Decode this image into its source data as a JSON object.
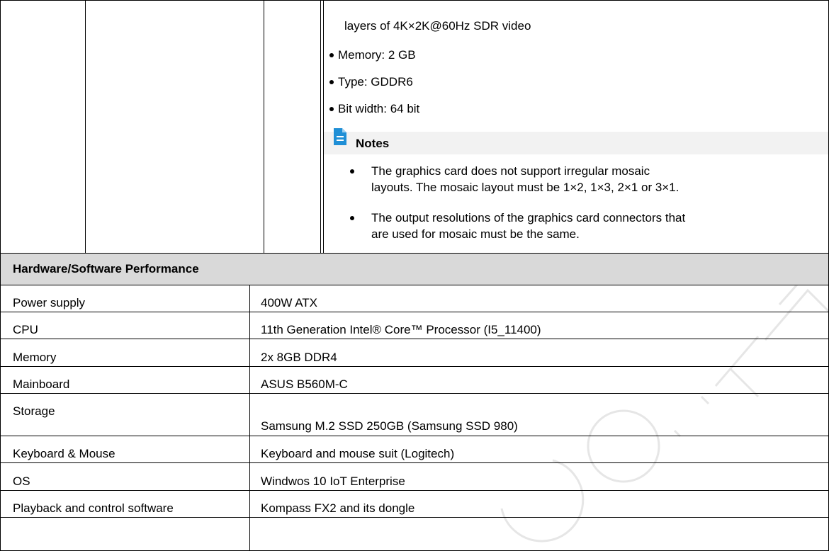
{
  "continued_cell": {
    "lines": [
      "layers of 4K×2K@60Hz SDR video",
      "Memory: 2 GB",
      "Type: GDDR6",
      "Bit width: 64 bit"
    ],
    "notes_title": "Notes",
    "notes": [
      [
        "The graphics card does not support irregular mosaic",
        "layouts. The mosaic layout must be 1×2, 1×3, 2×1 or 3×1."
      ],
      [
        "The output resolutions of the graphics card connectors that",
        "are used for mosaic must be the same."
      ]
    ]
  },
  "section": {
    "title": "Hardware/Software Performance"
  },
  "rows": [
    {
      "label": "Power supply",
      "value": "400W ATX"
    },
    {
      "label": "CPU",
      "value": "11th Generation Intel® Core™ Processor (I5_11400)"
    },
    {
      "label": "Memory",
      "value": "2x 8GB DDR4"
    },
    {
      "label": "Mainboard",
      "value": "ASUS B560M-C"
    },
    {
      "label": "Storage",
      "value": "Samsung M.2 SSD 250GB (Samsung SSD 980)"
    },
    {
      "label": "Keyboard & Mouse",
      "value": "Keyboard and mouse suit (Logitech)"
    },
    {
      "label": "OS",
      "value": "Windwos 10 IoT Enterprise"
    },
    {
      "label": "Playback and control software",
      "value": "Kompass FX2 and its dongle"
    }
  ],
  "watermark": {
    "text": "CO., LTD",
    "color": "#e6e6e6"
  },
  "colors": {
    "section_bg": "#d9d9d9",
    "notes_bg": "#f2f2f2",
    "notes_icon": "#1f8fd6"
  }
}
